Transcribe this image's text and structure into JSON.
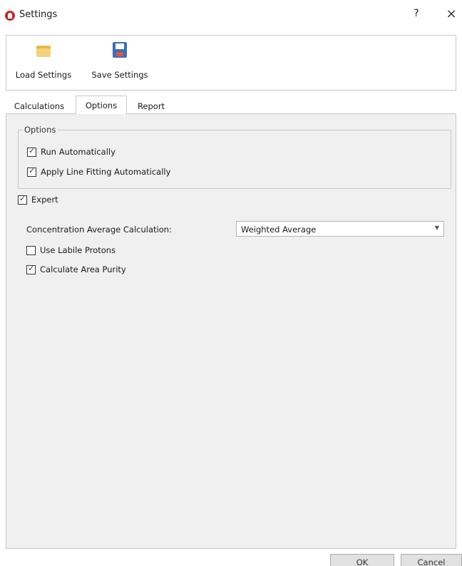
{
  "window": {
    "title": "Settings",
    "help_label": "?",
    "close_label": "×"
  },
  "toolbar": {
    "load_label": "Load Settings",
    "save_label": "Save Settings",
    "load_icon": "folder-icon",
    "save_icon": "floppy-disk-icon"
  },
  "tabs": [
    {
      "label": "Calculations",
      "active": false
    },
    {
      "label": "Options",
      "active": true
    },
    {
      "label": "Report",
      "active": false
    }
  ],
  "options_group": {
    "legend": "Options",
    "items": [
      {
        "label": "Run Automatically",
        "checked": true
      },
      {
        "label": "Apply Line Fitting Automatically",
        "checked": true
      }
    ]
  },
  "expert": {
    "label": "Expert",
    "checked": true
  },
  "concentration": {
    "label": "Concentration Average Calculation:",
    "value": "Weighted Average"
  },
  "use_labile": {
    "label": "Use Labile Protons",
    "checked": false
  },
  "area_purity": {
    "label": "Calculate Area Purity",
    "checked": true
  },
  "buttons": {
    "ok": "OK",
    "cancel": "Cancel"
  },
  "colors": {
    "app_icon": "#c62828",
    "panel_bg": "#f0f0f0",
    "border": "#c8c8c8"
  }
}
